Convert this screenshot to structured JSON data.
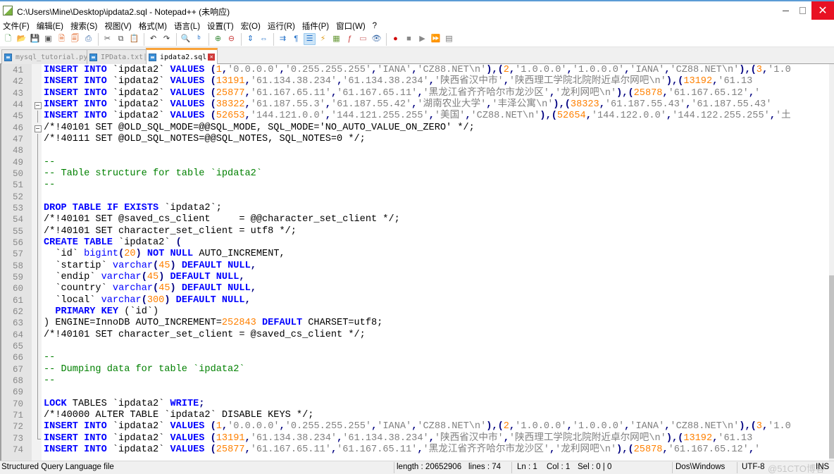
{
  "window": {
    "title": "C:\\Users\\Mine\\Desktop\\ipdata2.sql - Notepad++ (未响应)",
    "minimize_label": "minimize",
    "maximize_label": "maximize",
    "close_label": "✕"
  },
  "menu": [
    {
      "label": "文件(F)"
    },
    {
      "label": "编辑(E)"
    },
    {
      "label": "搜索(S)"
    },
    {
      "label": "视图(V)"
    },
    {
      "label": "格式(M)"
    },
    {
      "label": "语言(L)"
    },
    {
      "label": "设置(T)"
    },
    {
      "label": "宏(O)"
    },
    {
      "label": "运行(R)"
    },
    {
      "label": "插件(P)"
    },
    {
      "label": "窗口(W)"
    },
    {
      "label": "?"
    }
  ],
  "toolbar": [
    {
      "icon": "new-file-icon",
      "glyph": "🗋",
      "color": "#3a8a3a"
    },
    {
      "icon": "open-file-icon",
      "glyph": "📂",
      "color": "#e0a020"
    },
    {
      "icon": "save-icon",
      "glyph": "💾",
      "color": "#555"
    },
    {
      "icon": "save-all-icon",
      "glyph": "▣",
      "color": "#555"
    },
    {
      "icon": "close-file-icon",
      "glyph": "🗎",
      "color": "#e06020"
    },
    {
      "icon": "close-all-icon",
      "glyph": "🗐",
      "color": "#e06020"
    },
    {
      "icon": "print-icon",
      "glyph": "⎙",
      "color": "#3a6aa8"
    },
    {
      "sep": true
    },
    {
      "icon": "cut-icon",
      "glyph": "✂",
      "color": "#555"
    },
    {
      "icon": "copy-icon",
      "glyph": "⧉",
      "color": "#555"
    },
    {
      "icon": "paste-icon",
      "glyph": "📋",
      "color": "#555"
    },
    {
      "sep": true
    },
    {
      "icon": "undo-icon",
      "glyph": "↶",
      "color": "#333"
    },
    {
      "icon": "redo-icon",
      "glyph": "↷",
      "color": "#333"
    },
    {
      "sep": true
    },
    {
      "icon": "find-icon",
      "glyph": "🔍",
      "color": "#333"
    },
    {
      "icon": "replace-icon",
      "glyph": "ᵇ",
      "color": "#1e6ec8"
    },
    {
      "sep": true
    },
    {
      "icon": "zoom-in-icon",
      "glyph": "⊕",
      "color": "#3a8a3a"
    },
    {
      "icon": "zoom-out-icon",
      "glyph": "⊖",
      "color": "#c83a3a"
    },
    {
      "sep": true
    },
    {
      "icon": "sync-vertical-icon",
      "glyph": "⇕",
      "color": "#1e6ec8"
    },
    {
      "icon": "sync-horizontal-icon",
      "glyph": "⇔",
      "color": "#1e6ec8"
    },
    {
      "sep": true
    },
    {
      "icon": "word-wrap-icon",
      "glyph": "⇉",
      "color": "#1e6ec8"
    },
    {
      "icon": "show-all-chars-icon",
      "glyph": "¶",
      "color": "#1e6ec8"
    },
    {
      "icon": "indent-guide-icon",
      "glyph": "☰",
      "color": "#1e6ec8",
      "active": true
    },
    {
      "icon": "user-language-icon",
      "glyph": "⚡",
      "color": "#e0a020"
    },
    {
      "icon": "document-map-icon",
      "glyph": "▦",
      "color": "#6a9a3a"
    },
    {
      "icon": "function-list-icon",
      "glyph": "ƒ",
      "color": "#c83a3a"
    },
    {
      "icon": "folder-workspace-icon",
      "glyph": "▭",
      "color": "#d07070"
    },
    {
      "icon": "monitoring-icon",
      "glyph": "👁",
      "color": "#3a6aa8"
    },
    {
      "sep": true
    },
    {
      "icon": "record-macro-icon",
      "glyph": "●",
      "color": "#d00000"
    },
    {
      "icon": "stop-macro-icon",
      "glyph": "■",
      "color": "#888"
    },
    {
      "icon": "play-macro-icon",
      "glyph": "▶",
      "color": "#888"
    },
    {
      "icon": "run-macro-multiple-icon",
      "glyph": "⏩",
      "color": "#1e6ec8"
    },
    {
      "icon": "save-macro-icon",
      "glyph": "▤",
      "color": "#777"
    }
  ],
  "tabs": [
    {
      "label": "mysql_tutorial.py",
      "active": false
    },
    {
      "label": "IPData.txt",
      "active": false
    },
    {
      "label": "ipdata2.sql",
      "active": true
    }
  ],
  "editor": {
    "lines": [
      {
        "n": "41",
        "fold": "",
        "tokens": [
          [
            "kw",
            "INSERT INTO"
          ],
          [
            "",
            "` ipdata2`"
          ],
          [
            "",
            ""
          ]
        ]
      },
      {
        "n": "42",
        "fold": "",
        "tokens": []
      },
      {
        "n": "43",
        "fold": "",
        "tokens": []
      },
      {
        "n": "44",
        "fold": "box",
        "tokens": []
      },
      {
        "n": "45",
        "fold": "vline",
        "tokens": []
      },
      {
        "n": "46",
        "fold": "box",
        "tokens": []
      },
      {
        "n": "47",
        "fold": "vline",
        "tokens": []
      },
      {
        "n": "48",
        "fold": "vline",
        "tokens": []
      },
      {
        "n": "49",
        "fold": "vline",
        "tokens": []
      },
      {
        "n": "50",
        "fold": "vline",
        "tokens": []
      },
      {
        "n": "51",
        "fold": "vline",
        "tokens": []
      },
      {
        "n": "52",
        "fold": "vline",
        "tokens": []
      },
      {
        "n": "53",
        "fold": "vline",
        "tokens": []
      },
      {
        "n": "54",
        "fold": "vline",
        "tokens": []
      },
      {
        "n": "55",
        "fold": "vline",
        "tokens": []
      },
      {
        "n": "56",
        "fold": "vline",
        "tokens": []
      },
      {
        "n": "57",
        "fold": "vline",
        "tokens": []
      },
      {
        "n": "58",
        "fold": "vline",
        "tokens": []
      },
      {
        "n": "59",
        "fold": "vline",
        "tokens": []
      },
      {
        "n": "60",
        "fold": "vline",
        "tokens": []
      },
      {
        "n": "61",
        "fold": "vline",
        "tokens": []
      },
      {
        "n": "62",
        "fold": "vline",
        "tokens": []
      },
      {
        "n": "63",
        "fold": "vline",
        "tokens": []
      },
      {
        "n": "64",
        "fold": "vline",
        "tokens": []
      },
      {
        "n": "65",
        "fold": "vline",
        "tokens": []
      },
      {
        "n": "66",
        "fold": "vline",
        "tokens": []
      },
      {
        "n": "67",
        "fold": "vline",
        "tokens": []
      },
      {
        "n": "68",
        "fold": "vline",
        "tokens": []
      },
      {
        "n": "69",
        "fold": "vline",
        "tokens": []
      },
      {
        "n": "70",
        "fold": "vline",
        "tokens": []
      },
      {
        "n": "71",
        "fold": "vline",
        "tokens": []
      },
      {
        "n": "72",
        "fold": "vline",
        "tokens": []
      },
      {
        "n": "73",
        "fold": "end",
        "tokens": []
      },
      {
        "n": "74",
        "fold": "",
        "tokens": []
      }
    ]
  },
  "code": [
    [
      [
        "kw",
        "INSERT INTO"
      ],
      [
        "",
        " `ipdata2` "
      ],
      [
        "kw",
        "VALUES"
      ],
      [
        "op",
        " ("
      ],
      [
        "num",
        "1"
      ],
      [
        "op",
        ","
      ],
      [
        "str",
        "'0.0.0.0'"
      ],
      [
        "op",
        ","
      ],
      [
        "str",
        "'0.255.255.255'"
      ],
      [
        "op",
        ","
      ],
      [
        "str",
        "'IANA'"
      ],
      [
        "op",
        ","
      ],
      [
        "str",
        "'CZ88.NET\\n'"
      ],
      [
        "op",
        "),("
      ],
      [
        "num",
        "2"
      ],
      [
        "op",
        ","
      ],
      [
        "str",
        "'1.0.0.0'"
      ],
      [
        "op",
        ","
      ],
      [
        "str",
        "'1.0.0.0'"
      ],
      [
        "op",
        ","
      ],
      [
        "str",
        "'IANA'"
      ],
      [
        "op",
        ","
      ],
      [
        "str",
        "'CZ88.NET\\n'"
      ],
      [
        "op",
        "),("
      ],
      [
        "num",
        "3"
      ],
      [
        "op",
        ","
      ],
      [
        "str",
        "'1.0"
      ]
    ],
    [
      [
        "kw",
        "INSERT INTO"
      ],
      [
        "",
        " `ipdata2` "
      ],
      [
        "kw",
        "VALUES"
      ],
      [
        "op",
        " ("
      ],
      [
        "num",
        "13191"
      ],
      [
        "op",
        ","
      ],
      [
        "str",
        "'61.134.38.234'"
      ],
      [
        "op",
        ","
      ],
      [
        "str",
        "'61.134.38.234'"
      ],
      [
        "op",
        ","
      ],
      [
        "str",
        "'陕西省汉中市'"
      ],
      [
        "op",
        ","
      ],
      [
        "str",
        "'陕西理工学院北院附近卓尔网吧\\n'"
      ],
      [
        "op",
        "),("
      ],
      [
        "num",
        "13192"
      ],
      [
        "op",
        ","
      ],
      [
        "str",
        "'61.13"
      ]
    ],
    [
      [
        "kw",
        "INSERT INTO"
      ],
      [
        "",
        " `ipdata2` "
      ],
      [
        "kw",
        "VALUES"
      ],
      [
        "op",
        " ("
      ],
      [
        "num",
        "25877"
      ],
      [
        "op",
        ","
      ],
      [
        "str",
        "'61.167.65.11'"
      ],
      [
        "op",
        ","
      ],
      [
        "str",
        "'61.167.65.11'"
      ],
      [
        "op",
        ","
      ],
      [
        "str",
        "'黑龙江省齐齐哈尔市龙沙区'"
      ],
      [
        "op",
        ","
      ],
      [
        "str",
        "'龙利网吧\\n'"
      ],
      [
        "op",
        "),("
      ],
      [
        "num",
        "25878"
      ],
      [
        "op",
        ","
      ],
      [
        "str",
        "'61.167.65.12'"
      ],
      [
        "op",
        ","
      ],
      [
        "str",
        "'"
      ]
    ],
    [
      [
        "kw",
        "INSERT INTO"
      ],
      [
        "",
        " `ipdata2` "
      ],
      [
        "kw",
        "VALUES"
      ],
      [
        "op",
        " ("
      ],
      [
        "num",
        "38322"
      ],
      [
        "op",
        ","
      ],
      [
        "str",
        "'61.187.55.3'"
      ],
      [
        "op",
        ","
      ],
      [
        "str",
        "'61.187.55.42'"
      ],
      [
        "op",
        ","
      ],
      [
        "str",
        "'湖南农业大学'"
      ],
      [
        "op",
        ","
      ],
      [
        "str",
        "'丰泽公寓\\n'"
      ],
      [
        "op",
        "),("
      ],
      [
        "num",
        "38323"
      ],
      [
        "op",
        ","
      ],
      [
        "str",
        "'61.187.55.43'"
      ],
      [
        "op",
        ","
      ],
      [
        "str",
        "'61.187.55.43'"
      ]
    ],
    [
      [
        "kw",
        "INSERT INTO"
      ],
      [
        "",
        " `ipdata2` "
      ],
      [
        "kw",
        "VALUES"
      ],
      [
        "op",
        " ("
      ],
      [
        "num",
        "52653"
      ],
      [
        "op",
        ","
      ],
      [
        "str",
        "'144.121.0.0'"
      ],
      [
        "op",
        ","
      ],
      [
        "str",
        "'144.121.255.255'"
      ],
      [
        "op",
        ","
      ],
      [
        "str",
        "'美国'"
      ],
      [
        "op",
        ","
      ],
      [
        "str",
        "'CZ88.NET\\n'"
      ],
      [
        "op",
        "),("
      ],
      [
        "num",
        "52654"
      ],
      [
        "op",
        ","
      ],
      [
        "str",
        "'144.122.0.0'"
      ],
      [
        "op",
        ","
      ],
      [
        "str",
        "'144.122.255.255'"
      ],
      [
        "op",
        ","
      ],
      [
        "str",
        "'土"
      ]
    ],
    [
      [
        "",
        "/*!40101 SET @OLD_SQL_MODE=@@SQL_MODE, SQL_MODE='NO_AUTO_VALUE_ON_ZERO' */;"
      ]
    ],
    [
      [
        "",
        "/*!40111 SET @OLD_SQL_NOTES=@@SQL_NOTES, SQL_NOTES=0 */;"
      ]
    ],
    [],
    [
      [
        "cmt",
        "--"
      ]
    ],
    [
      [
        "cmt",
        "-- Table structure for table `ipdata2`"
      ]
    ],
    [
      [
        "cmt",
        "--"
      ]
    ],
    [],
    [
      [
        "kw",
        "DROP TABLE IF EXISTS"
      ],
      [
        "",
        " `ipdata2`;"
      ]
    ],
    [
      [
        "",
        "/*!40101 SET @saved_cs_client     = @@character_set_client */;"
      ]
    ],
    [
      [
        "",
        "/*!40101 SET character_set_client = utf8 */;"
      ]
    ],
    [
      [
        "kw",
        "CREATE TABLE"
      ],
      [
        "",
        " `ipdata2` "
      ],
      [
        "op",
        "("
      ]
    ],
    [
      [
        "",
        "  `id` "
      ],
      [
        "fn",
        "bigint"
      ],
      [
        "op",
        "("
      ],
      [
        "num",
        "20"
      ],
      [
        "op",
        ")"
      ],
      [
        "kw",
        " NOT NULL"
      ],
      [
        "",
        " AUTO_INCREMENT,"
      ]
    ],
    [
      [
        "",
        "  `startip` "
      ],
      [
        "fn",
        "varchar"
      ],
      [
        "op",
        "("
      ],
      [
        "num",
        "45"
      ],
      [
        "op",
        ")"
      ],
      [
        "kw",
        " DEFAULT NULL"
      ],
      [
        "op",
        ","
      ]
    ],
    [
      [
        "",
        "  `endip` "
      ],
      [
        "fn",
        "varchar"
      ],
      [
        "op",
        "("
      ],
      [
        "num",
        "45"
      ],
      [
        "op",
        ")"
      ],
      [
        "kw",
        " DEFAULT NULL"
      ],
      [
        "op",
        ","
      ]
    ],
    [
      [
        "",
        "  `country` "
      ],
      [
        "fn",
        "varchar"
      ],
      [
        "op",
        "("
      ],
      [
        "num",
        "45"
      ],
      [
        "op",
        ")"
      ],
      [
        "kw",
        " DEFAULT NULL"
      ],
      [
        "op",
        ","
      ]
    ],
    [
      [
        "",
        "  `local` "
      ],
      [
        "fn",
        "varchar"
      ],
      [
        "op",
        "("
      ],
      [
        "num",
        "300"
      ],
      [
        "op",
        ")"
      ],
      [
        "kw",
        " DEFAULT NULL"
      ],
      [
        "op",
        ","
      ]
    ],
    [
      [
        "kw",
        "  PRIMARY KEY"
      ],
      [
        "",
        " (`id`)"
      ]
    ],
    [
      [
        "",
        ") ENGINE=InnoDB AUTO_INCREMENT="
      ],
      [
        "num",
        "252843"
      ],
      [
        "kw",
        " DEFAULT"
      ],
      [
        "",
        " CHARSET=utf8;"
      ]
    ],
    [
      [
        "",
        "/*!40101 SET character_set_client = @saved_cs_client */;"
      ]
    ],
    [],
    [
      [
        "cmt",
        "--"
      ]
    ],
    [
      [
        "cmt",
        "-- Dumping data for table `ipdata2`"
      ]
    ],
    [
      [
        "cmt",
        "--"
      ]
    ],
    [],
    [
      [
        "kw",
        "LOCK"
      ],
      [
        "",
        " TABLES `ipdata2` "
      ],
      [
        "kw",
        "WRITE"
      ],
      [
        "op",
        ";"
      ]
    ],
    [
      [
        "",
        "/*!40000 ALTER TABLE `ipdata2` DISABLE KEYS */;"
      ]
    ],
    [
      [
        "kw",
        "INSERT INTO"
      ],
      [
        "",
        " `ipdata2` "
      ],
      [
        "kw",
        "VALUES"
      ],
      [
        "op",
        " ("
      ],
      [
        "num",
        "1"
      ],
      [
        "op",
        ","
      ],
      [
        "str",
        "'0.0.0.0'"
      ],
      [
        "op",
        ","
      ],
      [
        "str",
        "'0.255.255.255'"
      ],
      [
        "op",
        ","
      ],
      [
        "str",
        "'IANA'"
      ],
      [
        "op",
        ","
      ],
      [
        "str",
        "'CZ88.NET\\n'"
      ],
      [
        "op",
        "),("
      ],
      [
        "num",
        "2"
      ],
      [
        "op",
        ","
      ],
      [
        "str",
        "'1.0.0.0'"
      ],
      [
        "op",
        ","
      ],
      [
        "str",
        "'1.0.0.0'"
      ],
      [
        "op",
        ","
      ],
      [
        "str",
        "'IANA'"
      ],
      [
        "op",
        ","
      ],
      [
        "str",
        "'CZ88.NET\\n'"
      ],
      [
        "op",
        "),("
      ],
      [
        "num",
        "3"
      ],
      [
        "op",
        ","
      ],
      [
        "str",
        "'1.0"
      ]
    ],
    [
      [
        "kw",
        "INSERT INTO"
      ],
      [
        "",
        " `ipdata2` "
      ],
      [
        "kw",
        "VALUES"
      ],
      [
        "op",
        " ("
      ],
      [
        "num",
        "13191"
      ],
      [
        "op",
        ","
      ],
      [
        "str",
        "'61.134.38.234'"
      ],
      [
        "op",
        ","
      ],
      [
        "str",
        "'61.134.38.234'"
      ],
      [
        "op",
        ","
      ],
      [
        "str",
        "'陕西省汉中市'"
      ],
      [
        "op",
        ","
      ],
      [
        "str",
        "'陕西理工学院北院附近卓尔网吧\\n'"
      ],
      [
        "op",
        "),("
      ],
      [
        "num",
        "13192"
      ],
      [
        "op",
        ","
      ],
      [
        "str",
        "'61.13"
      ]
    ],
    [
      [
        "kw",
        "INSERT INTO"
      ],
      [
        "",
        " `ipdata2` "
      ],
      [
        "kw",
        "VALUES"
      ],
      [
        "op",
        " ("
      ],
      [
        "num",
        "25877"
      ],
      [
        "op",
        ","
      ],
      [
        "str",
        "'61.167.65.11'"
      ],
      [
        "op",
        ","
      ],
      [
        "str",
        "'61.167.65.11'"
      ],
      [
        "op",
        ","
      ],
      [
        "str",
        "'黑龙江省齐齐哈尔市龙沙区'"
      ],
      [
        "op",
        ","
      ],
      [
        "str",
        "'龙利网吧\\n'"
      ],
      [
        "op",
        "),("
      ],
      [
        "num",
        "25878"
      ],
      [
        "op",
        ","
      ],
      [
        "str",
        "'61.167.65.12'"
      ],
      [
        "op",
        ","
      ],
      [
        "str",
        "'"
      ]
    ]
  ],
  "status": {
    "file_type": "Structured Query Language file",
    "length": "length : 20652906",
    "lines": "lines : 74",
    "ln": "Ln : 1",
    "col": "Col : 1",
    "sel": "Sel : 0 | 0",
    "eol": "Dos\\Windows",
    "encoding": "UTF-8",
    "mode": "INS",
    "watermark": "@51CTO博客"
  }
}
